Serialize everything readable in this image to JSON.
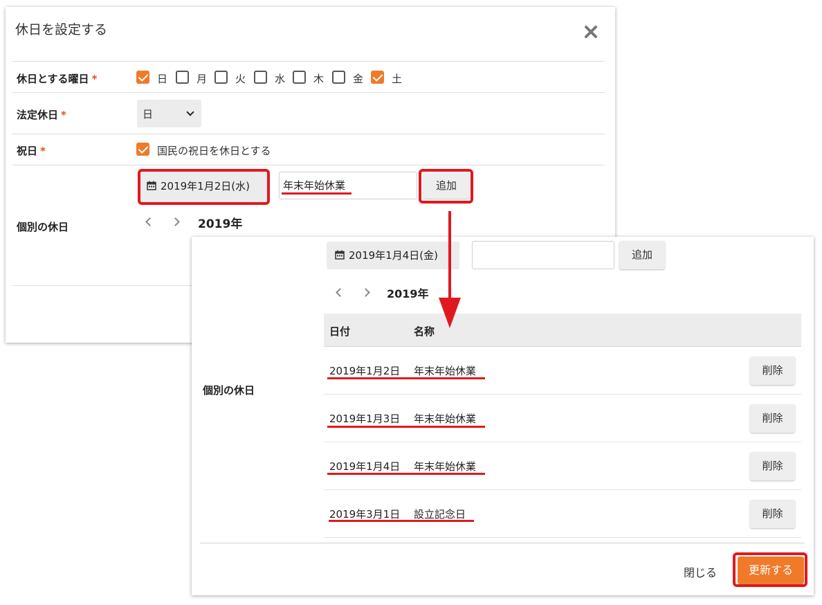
{
  "dialog1": {
    "title": "休日を設定する",
    "weekday_label": "休日とする曜日",
    "required_mark": "*",
    "weekdays": [
      {
        "label": "日",
        "checked": true
      },
      {
        "label": "月",
        "checked": false
      },
      {
        "label": "火",
        "checked": false
      },
      {
        "label": "水",
        "checked": false
      },
      {
        "label": "木",
        "checked": false
      },
      {
        "label": "金",
        "checked": false
      },
      {
        "label": "土",
        "checked": true
      }
    ],
    "legal_holiday_label": "法定休日",
    "legal_holiday_value": "日",
    "national_holiday_label": "祝日",
    "national_holiday_option": "国民の祝日を休日とする",
    "national_holiday_checked": true,
    "individual_label": "個別の休日",
    "date_value": "2019年1月2日(水)",
    "name_value": "年末年始休業",
    "add_label": "追加",
    "year": "2019年"
  },
  "dialog2": {
    "individual_label": "個別の休日",
    "date_value": "2019年1月4日(金)",
    "name_value": "",
    "add_label": "追加",
    "year": "2019年",
    "columns": [
      "日付",
      "名称"
    ],
    "rows": [
      {
        "date": "2019年1月2日",
        "name": "年末年始休業",
        "delete": "削除"
      },
      {
        "date": "2019年1月3日",
        "name": "年末年始休業",
        "delete": "削除"
      },
      {
        "date": "2019年1月4日",
        "name": "年末年始休業",
        "delete": "削除"
      },
      {
        "date": "2019年3月1日",
        "name": "設立記念日",
        "delete": "削除"
      }
    ],
    "close_label": "閉じる",
    "update_label": "更新する"
  },
  "colors": {
    "accent": "#f07a2a",
    "annotation_red": "#e0191e",
    "button_gray": "#ececec"
  },
  "icons": [
    "close-icon",
    "calendar-icon",
    "chevron-left-icon",
    "chevron-right-icon",
    "chevron-down-icon",
    "checkmark-icon"
  ]
}
